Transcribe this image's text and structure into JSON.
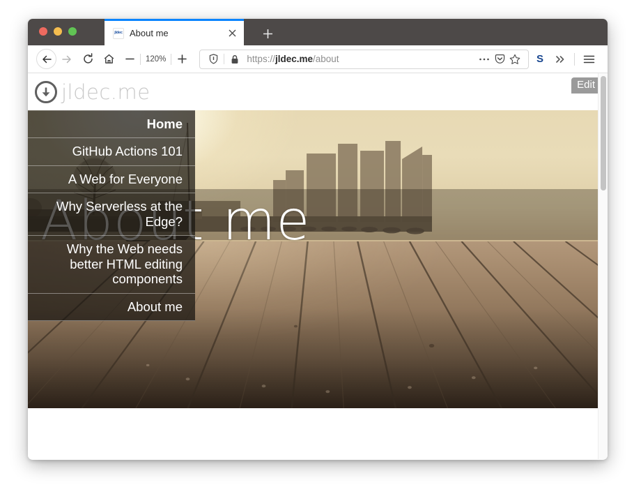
{
  "browser": {
    "window_buttons": [
      "close",
      "minimize",
      "maximize"
    ],
    "tab": {
      "title": "About me",
      "favicon_label": "jldec",
      "favicon_icon": "jldec-favicon",
      "close_icon": "close-icon",
      "accent_color": "#0a84ff"
    },
    "new_tab_label": "+",
    "toolbar": {
      "back_icon": "back-arrow-icon",
      "forward_icon": "forward-arrow-icon",
      "reload_icon": "reload-icon",
      "home_icon": "home-icon",
      "zoom_out_label": "−",
      "zoom_level": "120%",
      "zoom_in_label": "+",
      "tracking_protection_icon": "shield-icon",
      "lock_icon": "padlock-icon",
      "url_prefix": "https://",
      "url_domain": "jldec.me",
      "url_path": "/about",
      "page_actions_icon": "ellipsis-icon",
      "pocket_icon": "pocket-icon",
      "bookmark_icon": "star-icon",
      "extension_label": "S",
      "overflow_icon": "chevron-double-right-icon",
      "menu_icon": "hamburger-menu-icon"
    },
    "scrollbar": {
      "thumb_color": "#c4c4c4"
    }
  },
  "site": {
    "logo": {
      "icon": "download-circle-icon",
      "text": "jldec.me"
    },
    "edit_button_label": "Edit",
    "nav": {
      "items": [
        {
          "label": "Home",
          "current": true
        },
        {
          "label": "GitHub Actions 101",
          "current": false
        },
        {
          "label": "A Web for Everyone",
          "current": false
        },
        {
          "label": "Why Serverless at the Edge?",
          "current": false
        },
        {
          "label": "Why the Web needs better HTML editing components",
          "current": false
        },
        {
          "label": "About me",
          "current": false
        }
      ]
    },
    "hero": {
      "title": "About me",
      "image_description": "sunset-harbour-dock-photo",
      "colors": {
        "sky": "#e8dab6",
        "water": "#9b8c74",
        "dock": "#96795d",
        "nav_overlay": "#181410"
      }
    }
  }
}
